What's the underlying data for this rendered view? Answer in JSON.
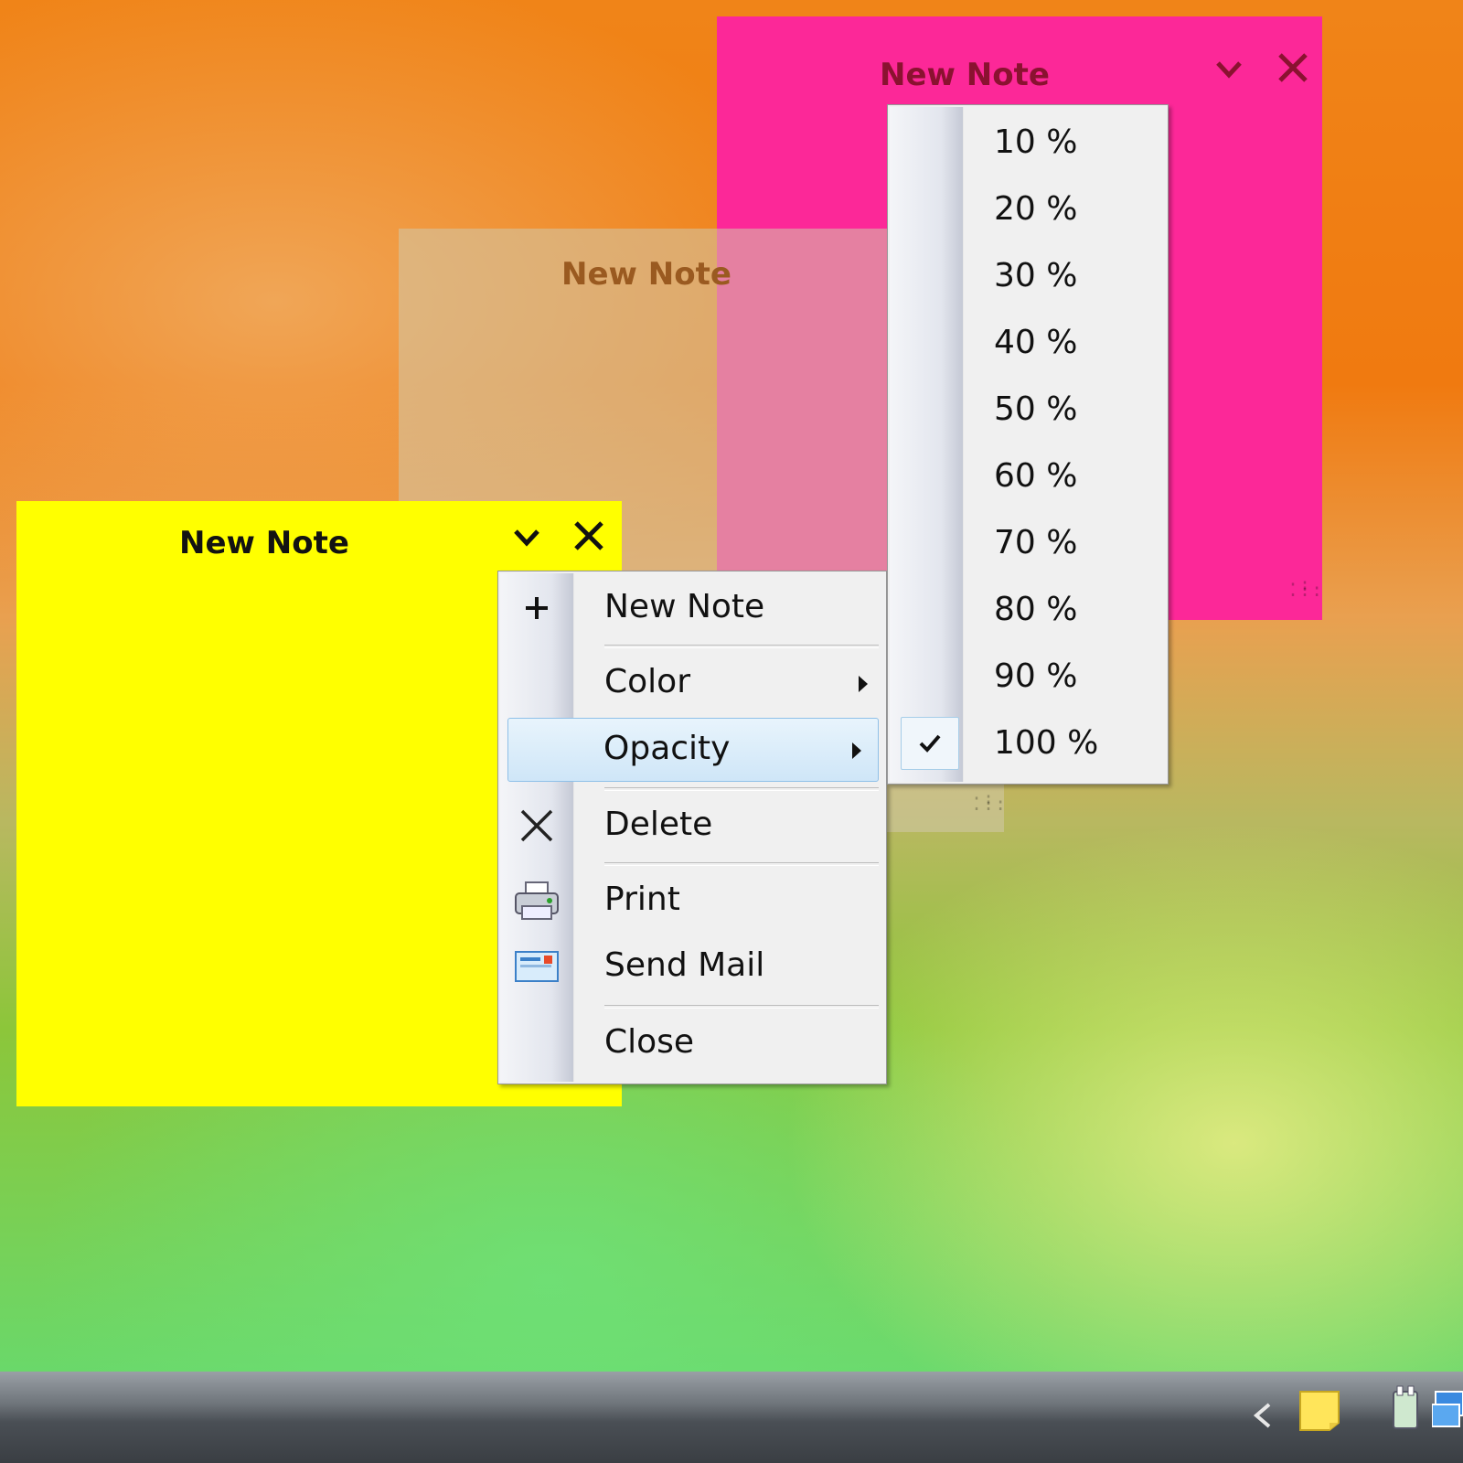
{
  "notes": {
    "pink": {
      "title": "New Note",
      "color": "#fc2898"
    },
    "tan": {
      "title": "New Note",
      "color": "#d2c8aa"
    },
    "yellow": {
      "title": "New Note",
      "color": "#ffff00"
    }
  },
  "context_menu": {
    "items": [
      {
        "label": "New Note",
        "icon": "plus-icon"
      },
      {
        "label": "Color",
        "icon": "",
        "submenu": true
      },
      {
        "label": "Opacity",
        "icon": "",
        "submenu": true,
        "highlighted": true
      },
      {
        "label": "Delete",
        "icon": "delete-x-icon"
      },
      {
        "label": "Print",
        "icon": "printer-icon"
      },
      {
        "label": "Send Mail",
        "icon": "mail-icon"
      },
      {
        "label": "Close",
        "icon": ""
      }
    ]
  },
  "opacity_menu": {
    "items": [
      "10 %",
      "20 %",
      "30 %",
      "40 %",
      "50 %",
      "60 %",
      "70 %",
      "80 %",
      "90 %",
      "100 %"
    ],
    "checked": "100 %"
  },
  "taskbar": {
    "tray_icons": [
      "chevron-left-icon",
      "sticky-note-icon",
      "power-icon",
      "network-icon"
    ]
  }
}
